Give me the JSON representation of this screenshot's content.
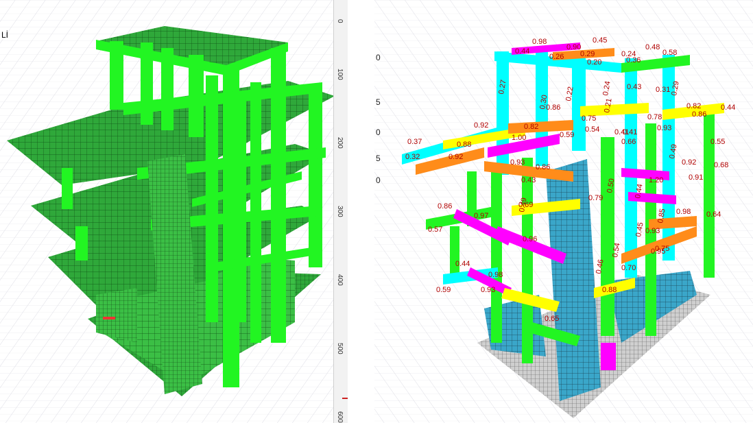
{
  "left_view": {
    "corner_label": "Lİ"
  },
  "ruler": {
    "labels": [
      "0",
      "100",
      "200",
      "300",
      "400",
      "500",
      "600"
    ]
  },
  "right_view": {
    "side_ticks": [
      "0",
      "5",
      "0",
      "5",
      "0"
    ],
    "ratios": [
      "0.98",
      "0.45",
      "0.90",
      "0.48",
      "0.58",
      "0.44",
      "0.26",
      "0.29",
      "0.24",
      "0.36",
      "0.20",
      "0.27",
      "0.30",
      "0.22",
      "0.24",
      "0.43",
      "0.31",
      "0.29",
      "0.86",
      "0.75",
      "0.21",
      "0.82",
      "0.86",
      "0.44",
      "0.37",
      "0.92",
      "0.82",
      "0.54",
      "0.41",
      "0.93",
      "0.55",
      "1.00",
      "0.59",
      "0.66",
      "0.88",
      "0.32",
      "0.92",
      "0.93",
      "0.86",
      "0.78",
      "0.49",
      "0.92",
      "0.43",
      "1.20",
      "0.91",
      "0.68",
      "0.50",
      "0.44",
      "0.86",
      "0.97",
      "0.69",
      "0.79",
      "0.49",
      "0.98",
      "0.64",
      "0.57",
      "0.96",
      "0.41",
      "0.93",
      "0.85",
      "0.45",
      "0.75",
      "0.44",
      "0.98",
      "0.59",
      "0.93",
      "0.65",
      "0.70",
      "0.54",
      "0.46",
      "0.88",
      "0.95"
    ]
  },
  "colors": {
    "frame_green": "#22f522",
    "slab_green": "#2fa83a",
    "cyan": "#00ffff",
    "orange": "#ff8c1a",
    "yellow": "#ffff00",
    "magenta": "#ff00ff",
    "wall_blue": "#3aa6c9",
    "ratio_text": "#b00000"
  }
}
